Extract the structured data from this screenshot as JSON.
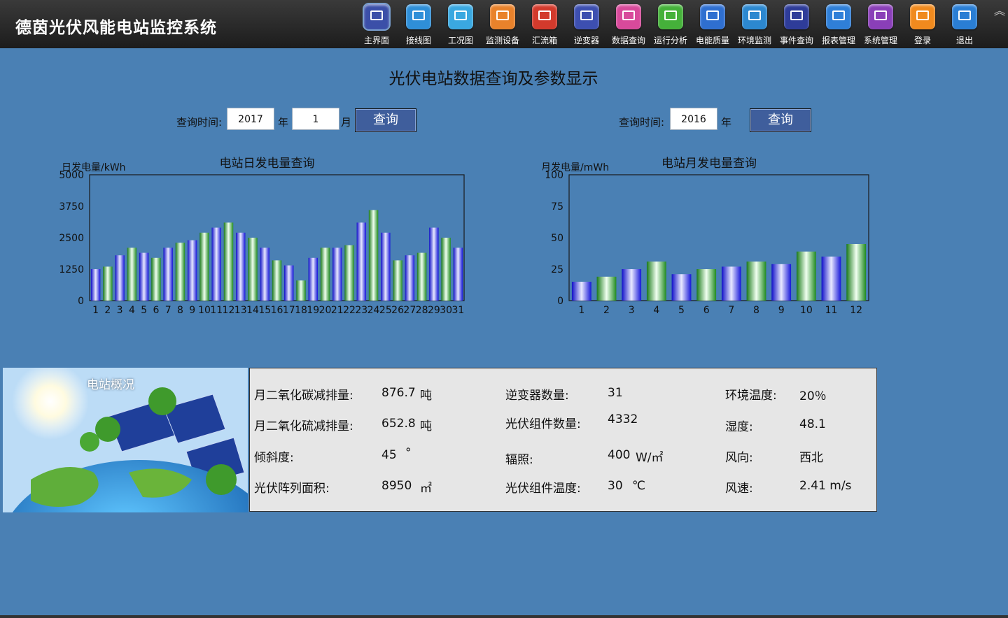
{
  "header": {
    "title": "德茵光伏风能电站监控系统"
  },
  "nav": [
    {
      "label": "主界面",
      "icon": "main-screen-icon",
      "color": "#3b4fa8",
      "active": true
    },
    {
      "label": "接线图",
      "icon": "wiring-icon",
      "color": "#2f8fd8"
    },
    {
      "label": "工况图",
      "icon": "condition-icon",
      "color": "#3aa8e0"
    },
    {
      "label": "监测设备",
      "icon": "monitor-device-icon",
      "color": "#e9822b"
    },
    {
      "label": "汇流箱",
      "icon": "combiner-box-icon",
      "color": "#d33a2c"
    },
    {
      "label": "逆变器",
      "icon": "inverter-icon",
      "color": "#3d4fb0"
    },
    {
      "label": "数据查询",
      "icon": "data-query-icon",
      "color": "#d84a9b"
    },
    {
      "label": "运行分析",
      "icon": "run-analysis-icon",
      "color": "#45b13a"
    },
    {
      "label": "电能质量",
      "icon": "power-quality-icon",
      "color": "#2f6fd0"
    },
    {
      "label": "环境监测",
      "icon": "environment-icon",
      "color": "#2c88d0"
    },
    {
      "label": "事件查询",
      "icon": "event-query-icon",
      "color": "#2e3c99"
    },
    {
      "label": "报表管理",
      "icon": "report-icon",
      "color": "#2f7fd8"
    },
    {
      "label": "系统管理",
      "icon": "system-settings-icon",
      "color": "#8a3fb8"
    },
    {
      "label": "登录",
      "icon": "login-icon",
      "color": "#f08a1e"
    },
    {
      "label": "退出",
      "icon": "logout-icon",
      "color": "#2a7ed4"
    }
  ],
  "page": {
    "title": "光伏电站数据查询及参数显示"
  },
  "query_daily": {
    "label": "查询时间:",
    "year": "2017",
    "year_unit": "年",
    "month": "1",
    "month_unit": "月",
    "button": "查询"
  },
  "query_monthly": {
    "label": "查询时间:",
    "year": "2016",
    "year_unit": "年",
    "button": "查询"
  },
  "colors": {
    "bar_blue": "#3434e8",
    "bar_green": "#2f9b2f",
    "background": "#4a80b4"
  },
  "chart_data": [
    {
      "type": "bar",
      "title": "电站日发电量查询",
      "ylabel": "日发电量/kWh",
      "xlabel": "",
      "ylim": [
        0,
        5000
      ],
      "yticks": [
        0,
        1250,
        2500,
        3750,
        5000
      ],
      "grid": false,
      "categories": [
        "1",
        "2",
        "3",
        "4",
        "5",
        "6",
        "7",
        "8",
        "9",
        "10",
        "11",
        "12",
        "13",
        "14",
        "15",
        "16",
        "17",
        "18",
        "19",
        "20",
        "21",
        "22",
        "23",
        "24",
        "25",
        "26",
        "27",
        "28",
        "29",
        "30",
        "31"
      ],
      "values": [
        1250,
        1350,
        1800,
        2100,
        1900,
        1700,
        2100,
        2300,
        2400,
        2700,
        2900,
        3100,
        2700,
        2500,
        2100,
        1600,
        1400,
        800,
        1700,
        2100,
        2100,
        2200,
        3100,
        3600,
        2700,
        1600,
        1800,
        1900,
        2900,
        2500,
        2100
      ]
    },
    {
      "type": "bar",
      "title": "电站月发电量查询",
      "ylabel": "月发电量/mWh",
      "xlabel": "",
      "ylim": [
        0,
        100
      ],
      "yticks": [
        0,
        25,
        50,
        75,
        100
      ],
      "grid": false,
      "categories": [
        "1",
        "2",
        "3",
        "4",
        "5",
        "6",
        "7",
        "8",
        "9",
        "10",
        "11",
        "12"
      ],
      "values": [
        15,
        19,
        25,
        31,
        21,
        25,
        27,
        31,
        29,
        39,
        35,
        45
      ]
    }
  ],
  "overview": {
    "label": "电站概况"
  },
  "stats": {
    "co2": {
      "label": "月二氧化碳减排量:",
      "value": "876.7",
      "unit": "吨"
    },
    "so2": {
      "label": "月二氧化硫减排量:",
      "value": "652.8",
      "unit": "吨"
    },
    "tilt": {
      "label": "倾斜度:",
      "value": "45",
      "unit": "°"
    },
    "area": {
      "label": "光伏阵列面积:",
      "value": "8950",
      "unit": "㎡"
    },
    "inverters": {
      "label": "逆变器数量:",
      "value": "31"
    },
    "modules": {
      "label": "光伏组件数量:",
      "value": "4332"
    },
    "irradiance": {
      "label": "辐照:",
      "value": "400",
      "unit": "W/㎡"
    },
    "module_temp": {
      "label": "光伏组件温度:",
      "value": "30",
      "unit": "℃"
    },
    "env_temp": {
      "label": "环境温度:",
      "value": "20％"
    },
    "humidity": {
      "label": "湿度:",
      "value": "48.1"
    },
    "wind_dir": {
      "label": "风向:",
      "value": "西北"
    },
    "wind_speed": {
      "label": "风速:",
      "value": "2.41 m/s"
    }
  }
}
